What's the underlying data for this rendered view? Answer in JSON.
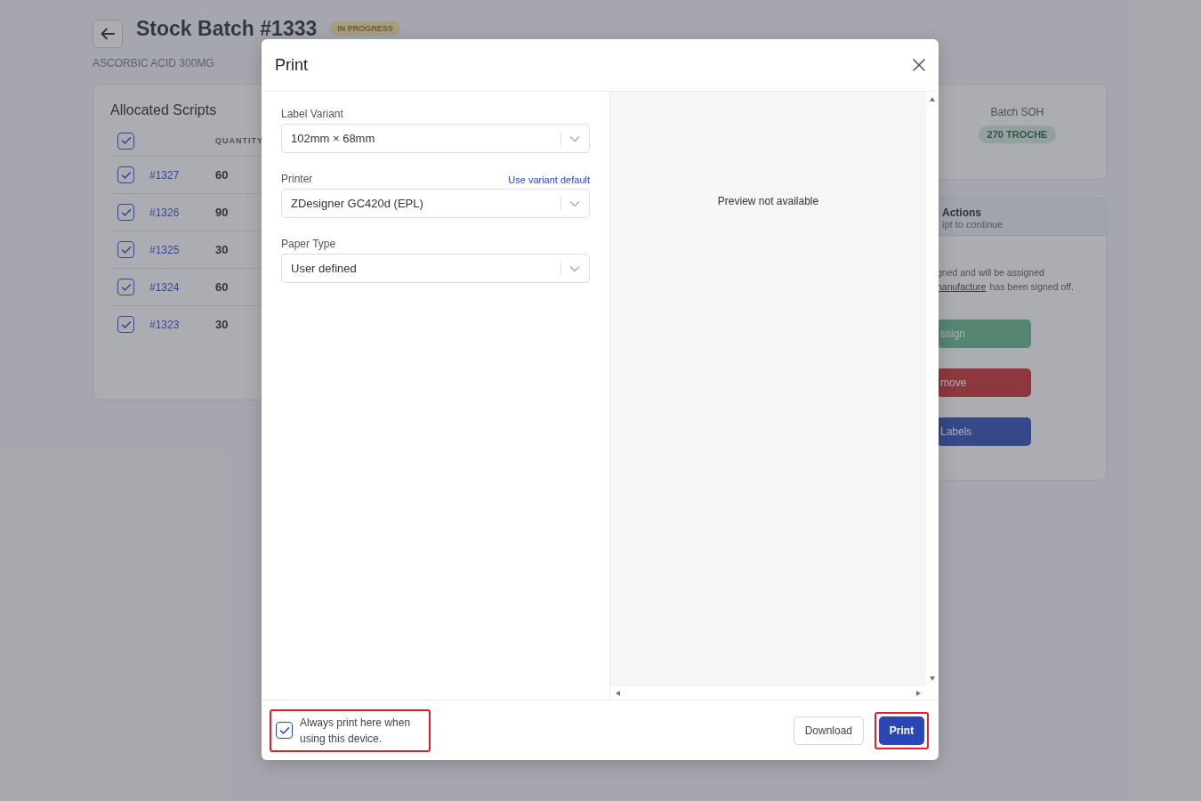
{
  "page": {
    "title": "Stock Batch #1333",
    "status_badge": "IN PROGRESS",
    "subtitle": "ASCORBIC ACID 300MG"
  },
  "allocated_scripts": {
    "title": "Allocated Scripts",
    "header_checked": true,
    "columns": [
      "QUANTITY"
    ],
    "rows": [
      {
        "script": "#1327",
        "quantity": "60",
        "checked": true
      },
      {
        "script": "#1326",
        "quantity": "90",
        "checked": true
      },
      {
        "script": "#1325",
        "quantity": "30",
        "checked": true
      },
      {
        "script": "#1324",
        "quantity": "60",
        "checked": true
      },
      {
        "script": "#1323",
        "quantity": "30",
        "checked": true
      }
    ]
  },
  "batch_soh": {
    "label": "Batch SOH",
    "value": "270 TROCHE"
  },
  "actions_panel": {
    "title": "Actions",
    "subtitle": "ipt to continue",
    "note_line_1": "gned and will be assigned",
    "note_link": "nanufacture",
    "note_line_2": "has been signed off.",
    "buttons": [
      {
        "label": "ssign",
        "kind": "success"
      },
      {
        "label": "move",
        "kind": "danger"
      },
      {
        "label": "Labels",
        "kind": "primary"
      }
    ]
  },
  "print_dialog": {
    "title": "Print",
    "fields": [
      {
        "label": "Label Variant",
        "value": "102mm × 68mm"
      },
      {
        "label": "Printer",
        "value": "ZDesigner GC420d (EPL)",
        "action": "Use variant default"
      },
      {
        "label": "Paper Type",
        "value": "User defined"
      }
    ],
    "preview_message": "Preview not available",
    "remember": {
      "label": "Always print here when using this device.",
      "checked": true,
      "highlighted": true
    },
    "buttons": [
      {
        "label": "Download",
        "kind": "secondary",
        "highlighted": false
      },
      {
        "label": "Print",
        "kind": "primary",
        "highlighted": true
      }
    ]
  }
}
